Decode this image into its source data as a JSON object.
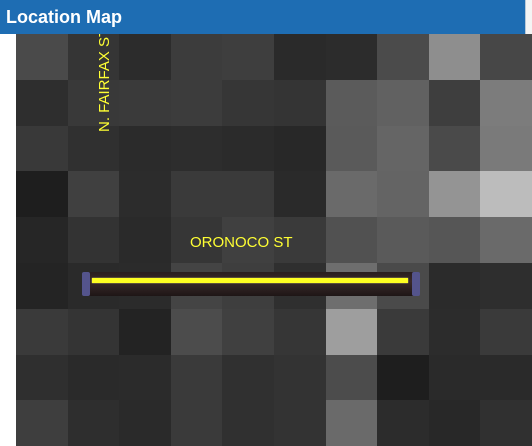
{
  "header": {
    "title": "Location Map"
  },
  "map": {
    "streets": [
      {
        "name": "N. FAIRFAX ST"
      },
      {
        "name": "ORONOCO ST"
      }
    ],
    "highlight_color": "#ffff22",
    "tile_shades": [
      "#4a4a4a",
      "#353535",
      "#2c2c2c",
      "#3c3c3c",
      "#3e3e3e",
      "#2a2a2a",
      "#2c2c2c",
      "#4b4b4b",
      "#8e8e8e",
      "#474747",
      "#2e2e2e",
      "#393939",
      "#3a3a3a",
      "#3c3c3c",
      "#363636",
      "#343434",
      "#5b5b5b",
      "#616161",
      "#3e3e3e",
      "#7c7c7c",
      "#393939",
      "#303030",
      "#2b2b2b",
      "#2d2d2d",
      "#2b2b2b",
      "#282828",
      "#5a5a5a",
      "#656565",
      "#4a4a4a",
      "#7a7a7a",
      "#1e1e1e",
      "#404040",
      "#2c2c2c",
      "#3a3a3a",
      "#3a3a3a",
      "#2a2a2a",
      "#6a6a6a",
      "#646464",
      "#949494",
      "#bcbcbc",
      "#262626",
      "#333333",
      "#2a2a2a",
      "#363636",
      "#404040",
      "#3a3a3a",
      "#515151",
      "#5a5a5a",
      "#565656",
      "#6a6a6a",
      "#242424",
      "#2a2a2a",
      "#2b2b2b",
      "#444444",
      "#3e3e3e",
      "#2f2f2f",
      "#6e6e6e",
      "#4a4a4a",
      "#2b2b2b",
      "#2e2e2e",
      "#3a3a3a",
      "#343434",
      "#232323",
      "#4c4c4c",
      "#404040",
      "#363636",
      "#9e9e9e",
      "#3a3a3a",
      "#2c2c2c",
      "#3a3a3a",
      "#2f2f2f",
      "#2a2a2a",
      "#2b2b2b",
      "#3a3a3a",
      "#303030",
      "#333333",
      "#4c4c4c",
      "#1e1e1e",
      "#2a2a2a",
      "#2a2a2a",
      "#3e3e3e",
      "#2e2e2e",
      "#2a2a2a",
      "#3a3a3a",
      "#303030",
      "#333333",
      "#6a6a6a",
      "#2c2c2c",
      "#282828",
      "#303030"
    ]
  }
}
